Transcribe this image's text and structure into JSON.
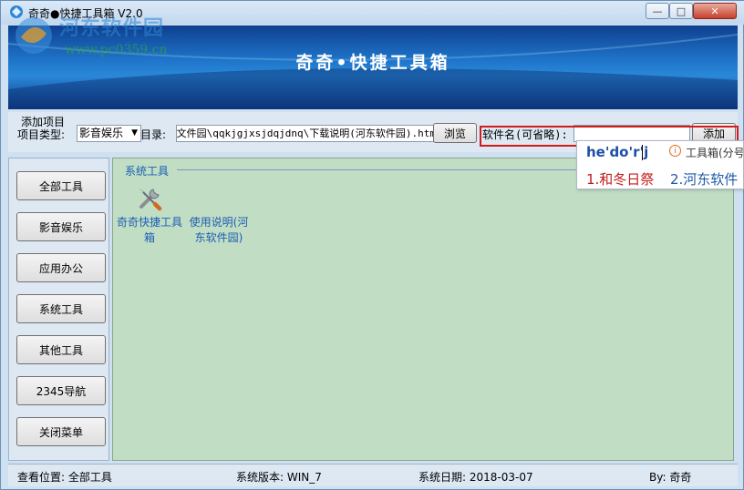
{
  "window": {
    "title": "奇奇●快捷工具箱 V2.0",
    "controls": {
      "minimize": "—",
      "maximize": "□",
      "close": "✕"
    }
  },
  "watermark": {
    "title": "河东软件园",
    "url": "www.pc0359.cn"
  },
  "banner": {
    "title": "奇奇•快捷工具箱"
  },
  "add_item": {
    "group_label": "添加项目",
    "type_label": "项目类型:",
    "type_value": "影音娱乐",
    "dir_label": "目录:",
    "dir_value": "文件园\\qqkjgjxsjdqjdnq\\下载说明(河东软件园).htm",
    "browse_label": "浏览",
    "name_label": "软件名(可省略):",
    "name_value": "",
    "add_label": "添加"
  },
  "ime": {
    "composition": "he'do'r'j",
    "hint": "工具箱(分号",
    "candidates": [
      "1.和冬日祭",
      "2.河东软件"
    ]
  },
  "sidebar": {
    "items": [
      {
        "label": "全部工具"
      },
      {
        "label": "影音娱乐"
      },
      {
        "label": "应用办公"
      },
      {
        "label": "系统工具"
      },
      {
        "label": "其他工具"
      },
      {
        "label": "2345导航"
      },
      {
        "label": "关闭菜单"
      }
    ]
  },
  "main": {
    "group_title": "系统工具",
    "tools": [
      {
        "label": "奇奇快捷工具箱",
        "icon": "wrench-screwdriver-icon"
      },
      {
        "label": "使用说明(河东软件园)",
        "icon": "none"
      }
    ]
  },
  "status": {
    "location": "查看位置: 全部工具",
    "version": "系统版本: WIN_7",
    "date": "系统日期: 2018-03-07",
    "author": "By: 奇奇"
  },
  "colors": {
    "highlight_box": "#d21b1b",
    "main_panel_bg": "#c1ddc4",
    "link_text": "#1a5fb4",
    "banner": "#1e73c8"
  }
}
